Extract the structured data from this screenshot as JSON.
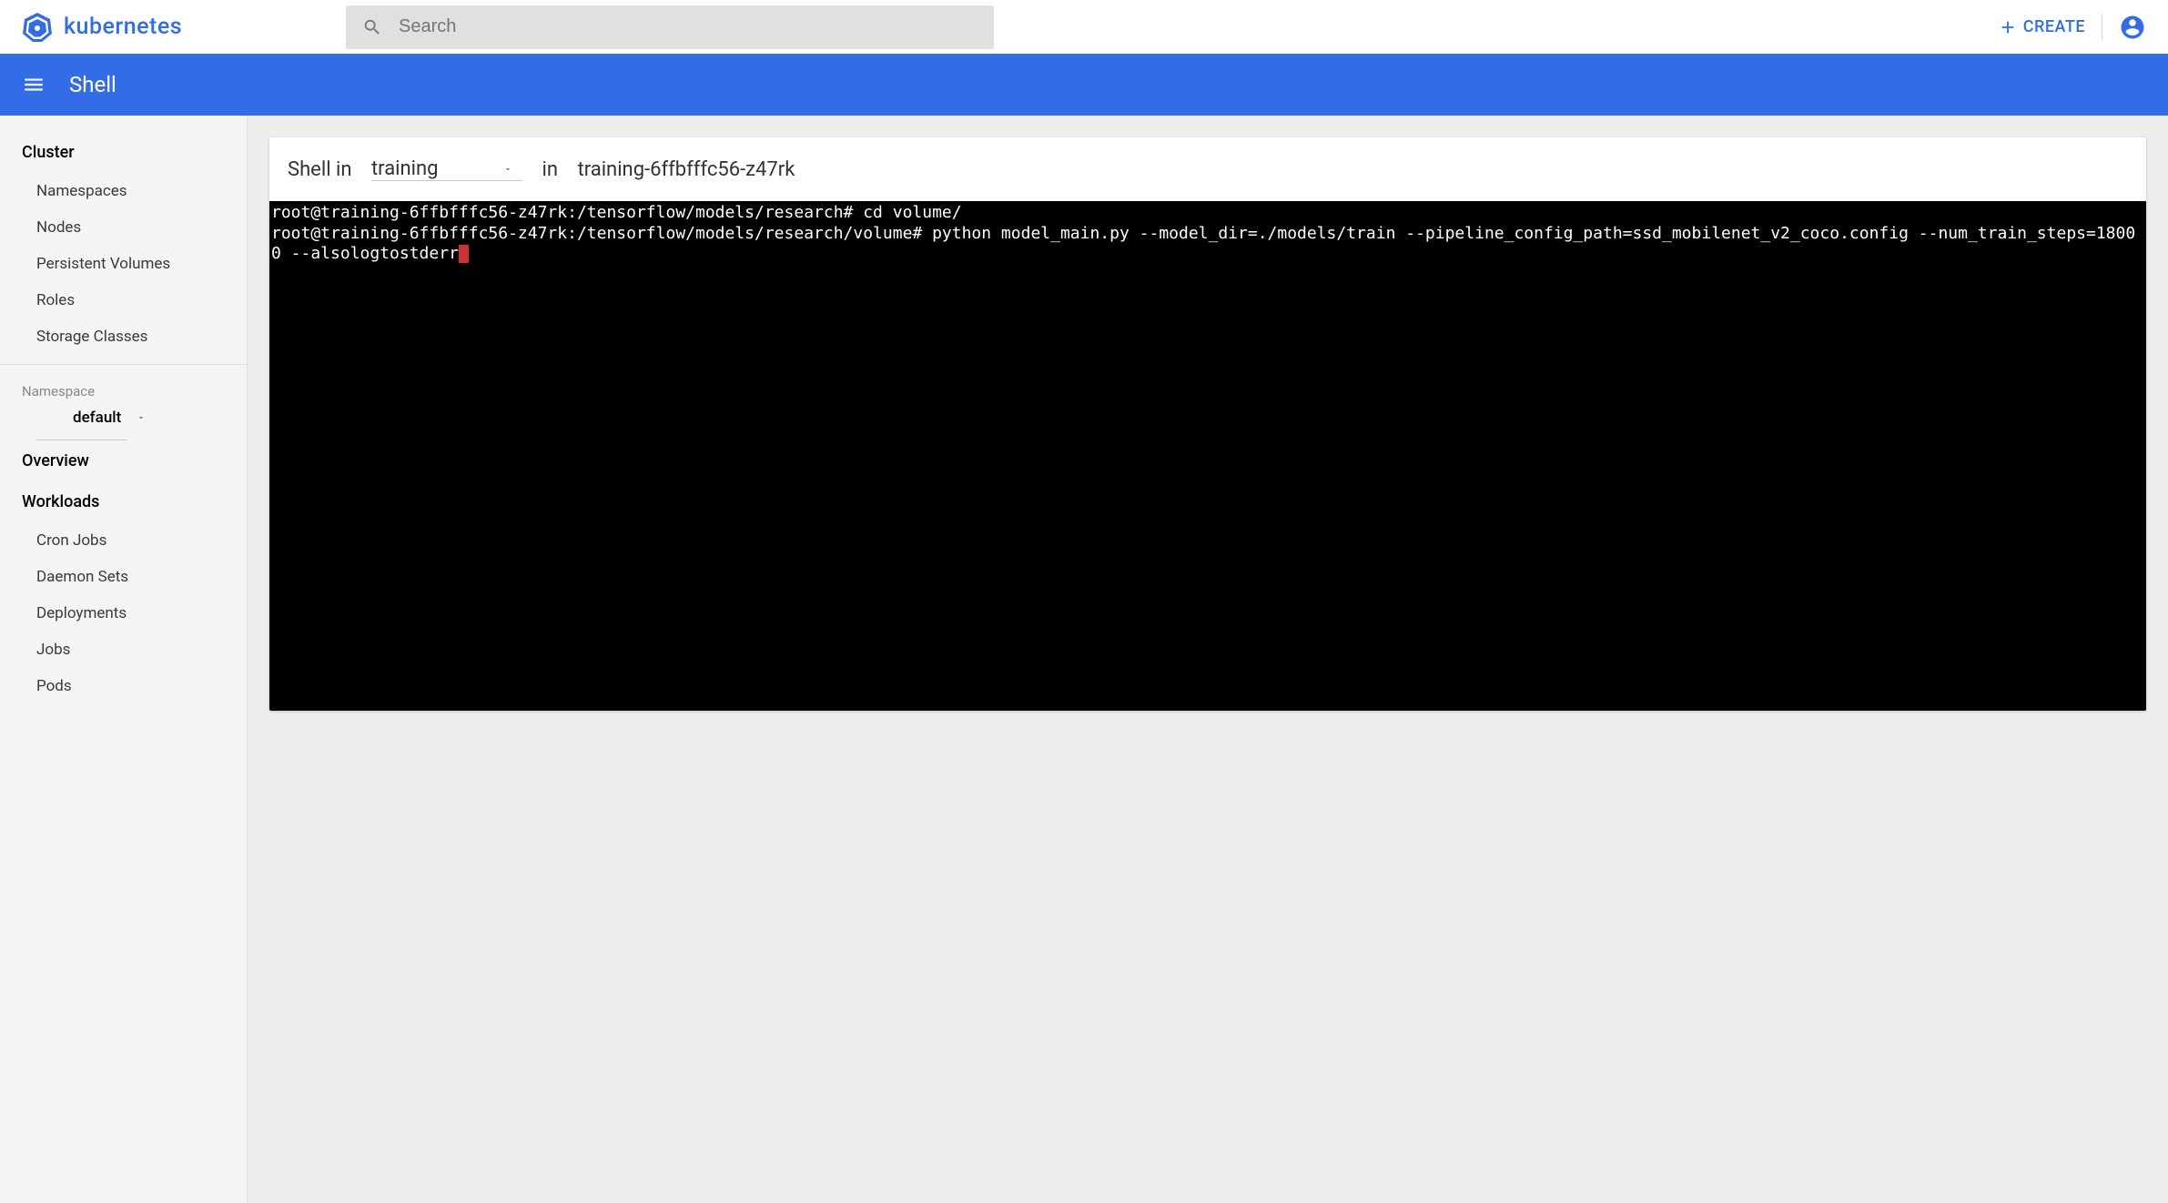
{
  "app": {
    "name": "kubernetes"
  },
  "search": {
    "placeholder": "Search"
  },
  "create": {
    "label": "CREATE"
  },
  "actionbar": {
    "title": "Shell"
  },
  "sidebar": {
    "cluster": {
      "title": "Cluster",
      "items": [
        "Namespaces",
        "Nodes",
        "Persistent Volumes",
        "Roles",
        "Storage Classes"
      ]
    },
    "namespace": {
      "label": "Namespace",
      "value": "default"
    },
    "overview": "Overview",
    "workloads": {
      "title": "Workloads",
      "items": [
        "Cron Jobs",
        "Daemon Sets",
        "Deployments",
        "Jobs",
        "Pods"
      ]
    }
  },
  "shell": {
    "prefix": "Shell in",
    "container": "training",
    "in": "in",
    "pod": "training-6ffbfffc56-z47rk",
    "terminal_text": "root@training-6ffbfffc56-z47rk:/tensorflow/models/research# cd volume/\nroot@training-6ffbfffc56-z47rk:/tensorflow/models/research/volume# python model_main.py --model_dir=./models/train --pipeline_config_path=ssd_mobilenet_v2_coco.config --num_train_steps=18000 --alsologtostderr"
  }
}
